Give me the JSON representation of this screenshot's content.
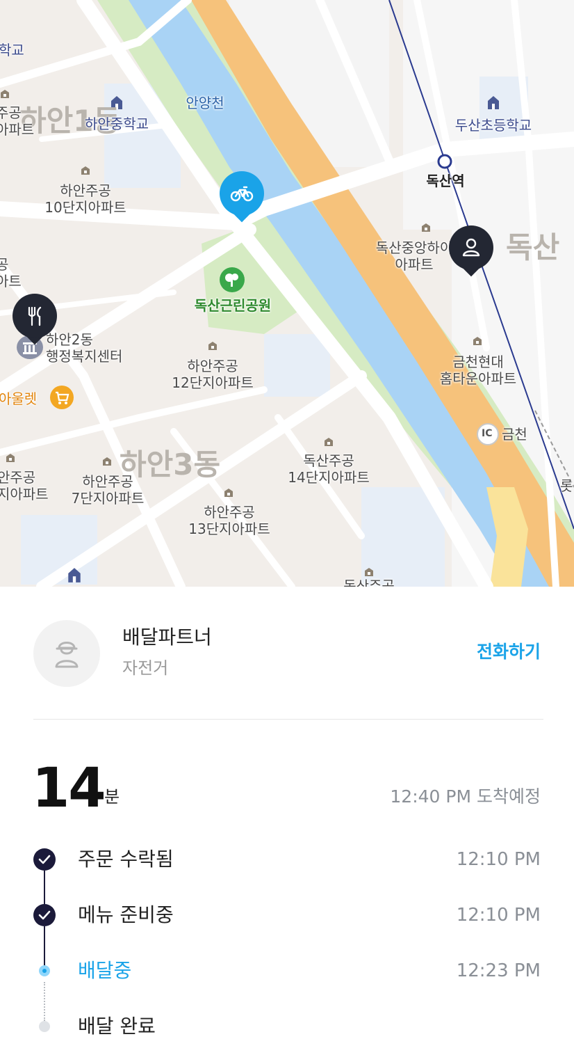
{
  "map": {
    "labels": {
      "school_top_left": "학교",
      "hanan_jung": "하안중학교",
      "hanan1": "하안1동",
      "hanan_apt_left": "주공\n아파트",
      "hanan10": "하안주공\n10단지아파트",
      "gong_apt": "공\n아트",
      "anyang_river": "안양천",
      "dusan_elem": "두산초등학교",
      "doksan_station": "독산역",
      "doksan_jungang": "독산중앙하이\n아파트",
      "doksan_big": "독산",
      "doksan_park": "독산근린공원",
      "hanan2_office": "하안2동\n행정복지센터",
      "hanan12": "하안주공\n12단지아파트",
      "geumcheon_hyundai": "금천현대\n홈타운아파트",
      "outlet": "아울렛",
      "ic_geumcheon": "금천",
      "ic_badge": "IC",
      "hanan3": "하안3동",
      "doksan14": "독산주공\n14단지아파트",
      "hanan_left_bottom": "안주공\n지아파트",
      "hanan7": "하안주공\n7단지아파트",
      "hanan13": "하안주공\n13단지아파트",
      "lotte_partial": "롯",
      "bottom_partial": "독산주공"
    },
    "pins": {
      "rider": "bicycle-icon",
      "customer": "person-icon",
      "restaurant": "fork-knife-icon"
    },
    "colors": {
      "river": "#a9d3f5",
      "park": "#d8ecc4",
      "highway": "#f6c27b",
      "rider_pin": "#1aa3e8",
      "dark_pin": "#232733"
    }
  },
  "partner": {
    "name": "배달파트너",
    "vehicle": "자전거",
    "call_label": "전화하기"
  },
  "eta": {
    "minutes": "14",
    "unit": "분",
    "arrival": "12:40 PM 도착예정"
  },
  "steps": [
    {
      "label": "주문 수락됨",
      "time": "12:10 PM",
      "state": "done"
    },
    {
      "label": "메뉴 준비중",
      "time": "12:10 PM",
      "state": "done"
    },
    {
      "label": "배달중",
      "time": "12:23 PM",
      "state": "active"
    },
    {
      "label": "배달 완료",
      "time": "",
      "state": "pending"
    }
  ],
  "accent_color": "#1aa3e8"
}
